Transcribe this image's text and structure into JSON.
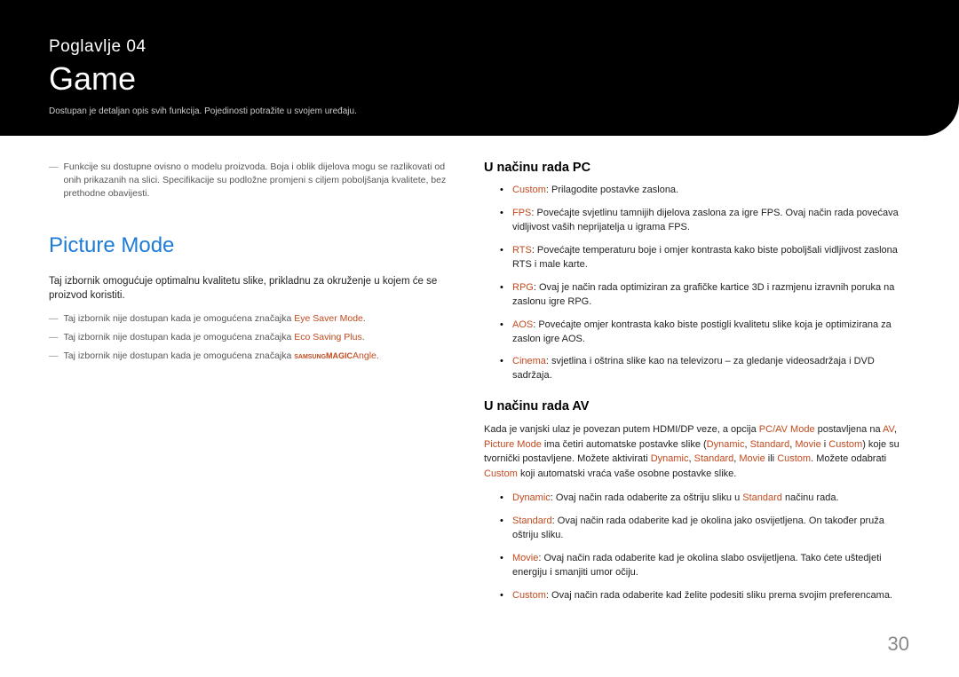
{
  "header": {
    "chapter": "Poglavlje  04",
    "title": "Game",
    "subtitle": "Dostupan je detaljan opis svih funkcija. Pojedinosti potražite u svojem uređaju."
  },
  "left": {
    "note1": "Funkcije su dostupne ovisno o modelu proizvoda. Boja i oblik dijelova mogu se razlikovati od onih prikazanih na slici. Specifikacije su podložne promjeni s ciljem poboljšanja kvalitete, bez prethodne obavijesti.",
    "heading": "Picture Mode",
    "body": "Taj izbornik omogućuje optimalnu kvalitetu slike, prikladnu za okruženje u kojem će se proizvod koristiti.",
    "n_a": "Taj izbornik nije dostupan kada je omogućena značajka ",
    "n_a_hl1": "Eye Saver Mode",
    "n_b": "Taj izbornik nije dostupan kada je omogućena značajka ",
    "n_b_hl1": "Eco Saving Plus",
    "n_c": "Taj izbornik nije dostupan kada je omogućena značajka ",
    "n_c_sup": "SAMSUNG",
    "n_c_magic": "MAGIC",
    "n_c_angle": "Angle",
    "period": "."
  },
  "right": {
    "pc_heading": "U načinu rada PC",
    "pc": [
      {
        "hl": "Custom",
        "txt": ": Prilagodite postavke zaslona."
      },
      {
        "hl": "FPS",
        "txt": ": Povećajte svjetlinu tamnijih dijelova zaslona za igre FPS. Ovaj način rada povećava vidljivost vaših neprijatelja u igrama FPS."
      },
      {
        "hl": "RTS",
        "txt": ": Povećajte temperaturu boje i omjer kontrasta kako biste poboljšali vidljivost zaslona RTS i male karte."
      },
      {
        "hl": "RPG",
        "txt": ": Ovaj je način rada optimiziran za grafičke kartice 3D i razmjenu izravnih poruka na zaslonu igre RPG."
      },
      {
        "hl": "AOS",
        "txt": ": Povećajte omjer kontrasta kako biste postigli kvalitetu slike koja je optimizirana za zaslon igre AOS."
      },
      {
        "hl": "Cinema",
        "txt": ": svjetlina i oštrina slike kao na televizoru – za gledanje videosadržaja i DVD sadržaja."
      }
    ],
    "av_heading": "U načinu rada AV",
    "av_para": {
      "p1": "Kada je vanjski ulaz je povezan putem HDMI/DP veze, a opcija ",
      "h1": "PC/AV Mode",
      "p2": " postavljena na ",
      "h2": "AV",
      "p3": ", ",
      "h3": "Picture Mode",
      "p4": " ima četiri automatske postavke slike (",
      "h4": "Dynamic",
      "p5": ", ",
      "h5": "Standard",
      "p6": ", ",
      "h6": "Movie",
      "p7": " i ",
      "h7": "Custom",
      "p8": ") koje su tvornički postavljene. Možete aktivirati ",
      "h8": "Dynamic",
      "p9": ", ",
      "h9": "Standard",
      "p10": ", ",
      "h10": "Movie",
      "p11": " ili ",
      "h11": "Custom",
      "p12": ". Možete odabrati ",
      "h12": "Custom",
      "p13": " koji automatski vraća vaše osobne postavke slike."
    },
    "av": [
      {
        "hl": "Dynamic",
        "a": ": Ovaj način rada odaberite za oštriju sliku u ",
        "hl2": "Standard",
        "b": " načinu rada."
      },
      {
        "hl": "Standard",
        "a": ": Ovaj način rada odaberite kad je okolina jako osvijetljena. On također pruža oštriju sliku."
      },
      {
        "hl": "Movie",
        "a": ": Ovaj način rada odaberite kad je okolina slabo osvijetljena. Tako ćete uštedjeti energiju i smanjiti umor očiju."
      },
      {
        "hl": "Custom",
        "a": ": Ovaj način rada odaberite kad želite podesiti sliku prema svojim preferencama."
      }
    ]
  },
  "page_number": "30"
}
